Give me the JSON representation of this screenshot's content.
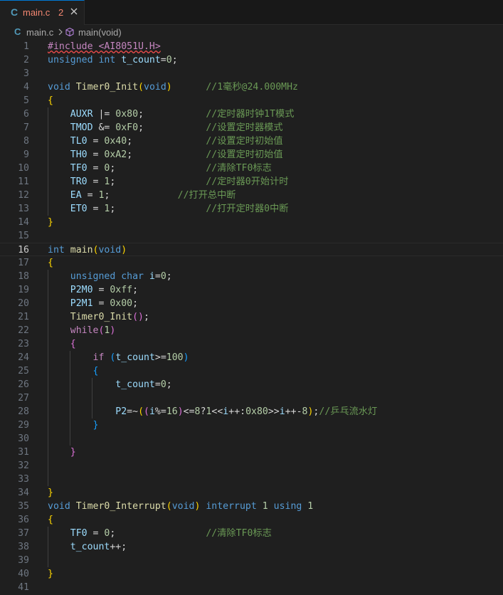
{
  "tab": {
    "language_icon": "C",
    "filename": "main.c",
    "problem_count": "2",
    "close_icon": "close-icon"
  },
  "breadcrumb": {
    "language_icon": "C",
    "file": "main.c",
    "symbol": "main(void)",
    "separator_icon": "chevron-right-icon",
    "symbol_icon": "cube-icon"
  },
  "editor": {
    "current_line": 16,
    "lines": [
      [
        {
          "t": "#include <AI8051U.H>",
          "c": "ctl err"
        }
      ],
      [
        {
          "t": "unsigned int ",
          "c": "kw"
        },
        {
          "t": "t_count",
          "c": "var"
        },
        {
          "t": "=",
          "c": "plain"
        },
        {
          "t": "0",
          "c": "num"
        },
        {
          "t": ";",
          "c": "plain"
        }
      ],
      [],
      [
        {
          "t": "void ",
          "c": "kw"
        },
        {
          "t": "Timer0_Init",
          "c": "fn"
        },
        {
          "t": "(",
          "c": "b1"
        },
        {
          "t": "void",
          "c": "kw"
        },
        {
          "t": ")",
          "c": "b1"
        },
        {
          "t": "      ",
          "c": "plain"
        },
        {
          "t": "//1毫秒@24.000MHz",
          "c": "cmt"
        }
      ],
      [
        {
          "t": "{",
          "c": "b1"
        }
      ],
      [
        {
          "t": "    ",
          "c": "plain"
        },
        {
          "t": "AUXR",
          "c": "var"
        },
        {
          "t": " |= ",
          "c": "plain"
        },
        {
          "t": "0x80",
          "c": "num"
        },
        {
          "t": ";           ",
          "c": "plain"
        },
        {
          "t": "//定时器时钟1T模式",
          "c": "cmt"
        }
      ],
      [
        {
          "t": "    ",
          "c": "plain"
        },
        {
          "t": "TMOD",
          "c": "var"
        },
        {
          "t": " &= ",
          "c": "plain"
        },
        {
          "t": "0xF0",
          "c": "num"
        },
        {
          "t": ";           ",
          "c": "plain"
        },
        {
          "t": "//设置定时器模式",
          "c": "cmt"
        }
      ],
      [
        {
          "t": "    ",
          "c": "plain"
        },
        {
          "t": "TL0",
          "c": "var"
        },
        {
          "t": " = ",
          "c": "plain"
        },
        {
          "t": "0x40",
          "c": "num"
        },
        {
          "t": ";             ",
          "c": "plain"
        },
        {
          "t": "//设置定时初始值",
          "c": "cmt"
        }
      ],
      [
        {
          "t": "    ",
          "c": "plain"
        },
        {
          "t": "TH0",
          "c": "var"
        },
        {
          "t": " = ",
          "c": "plain"
        },
        {
          "t": "0xA2",
          "c": "num"
        },
        {
          "t": ";             ",
          "c": "plain"
        },
        {
          "t": "//设置定时初始值",
          "c": "cmt"
        }
      ],
      [
        {
          "t": "    ",
          "c": "plain"
        },
        {
          "t": "TF0",
          "c": "var"
        },
        {
          "t": " = ",
          "c": "plain"
        },
        {
          "t": "0",
          "c": "num"
        },
        {
          "t": ";                ",
          "c": "plain"
        },
        {
          "t": "//清除TF0标志",
          "c": "cmt"
        }
      ],
      [
        {
          "t": "    ",
          "c": "plain"
        },
        {
          "t": "TR0",
          "c": "var"
        },
        {
          "t": " = ",
          "c": "plain"
        },
        {
          "t": "1",
          "c": "num"
        },
        {
          "t": ";                ",
          "c": "plain"
        },
        {
          "t": "//定时器0开始计时",
          "c": "cmt"
        }
      ],
      [
        {
          "t": "    ",
          "c": "plain"
        },
        {
          "t": "EA",
          "c": "var"
        },
        {
          "t": " = ",
          "c": "plain"
        },
        {
          "t": "1",
          "c": "num"
        },
        {
          "t": ";            ",
          "c": "plain"
        },
        {
          "t": "//打开总中断",
          "c": "cmt"
        }
      ],
      [
        {
          "t": "    ",
          "c": "plain"
        },
        {
          "t": "ET0",
          "c": "var"
        },
        {
          "t": " = ",
          "c": "plain"
        },
        {
          "t": "1",
          "c": "num"
        },
        {
          "t": ";                ",
          "c": "plain"
        },
        {
          "t": "//打开定时器0中断",
          "c": "cmt"
        }
      ],
      [
        {
          "t": "}",
          "c": "b1"
        }
      ],
      [],
      [
        {
          "t": "int ",
          "c": "kw"
        },
        {
          "t": "main",
          "c": "fn"
        },
        {
          "t": "(",
          "c": "b1"
        },
        {
          "t": "void",
          "c": "kw"
        },
        {
          "t": ")",
          "c": "b1"
        }
      ],
      [
        {
          "t": "{",
          "c": "b1"
        }
      ],
      [
        {
          "t": "    ",
          "c": "plain"
        },
        {
          "t": "unsigned char ",
          "c": "kw"
        },
        {
          "t": "i",
          "c": "var"
        },
        {
          "t": "=",
          "c": "plain"
        },
        {
          "t": "0",
          "c": "num"
        },
        {
          "t": ";",
          "c": "plain"
        }
      ],
      [
        {
          "t": "    ",
          "c": "plain"
        },
        {
          "t": "P2M0",
          "c": "var"
        },
        {
          "t": " = ",
          "c": "plain"
        },
        {
          "t": "0xff",
          "c": "num"
        },
        {
          "t": ";",
          "c": "plain"
        }
      ],
      [
        {
          "t": "    ",
          "c": "plain"
        },
        {
          "t": "P2M1",
          "c": "var"
        },
        {
          "t": " = ",
          "c": "plain"
        },
        {
          "t": "0x00",
          "c": "num"
        },
        {
          "t": ";",
          "c": "plain"
        }
      ],
      [
        {
          "t": "    ",
          "c": "plain"
        },
        {
          "t": "Timer0_Init",
          "c": "fn"
        },
        {
          "t": "()",
          "c": "b2"
        },
        {
          "t": ";",
          "c": "plain"
        }
      ],
      [
        {
          "t": "    ",
          "c": "plain"
        },
        {
          "t": "while",
          "c": "ctl"
        },
        {
          "t": "(",
          "c": "b2"
        },
        {
          "t": "1",
          "c": "num"
        },
        {
          "t": ")",
          "c": "b2"
        }
      ],
      [
        {
          "t": "    ",
          "c": "plain"
        },
        {
          "t": "{",
          "c": "b2"
        }
      ],
      [
        {
          "t": "        ",
          "c": "plain"
        },
        {
          "t": "if ",
          "c": "ctl"
        },
        {
          "t": "(",
          "c": "b3"
        },
        {
          "t": "t_count",
          "c": "var"
        },
        {
          "t": ">=",
          "c": "plain"
        },
        {
          "t": "100",
          "c": "num"
        },
        {
          "t": ")",
          "c": "b3"
        }
      ],
      [
        {
          "t": "        ",
          "c": "plain"
        },
        {
          "t": "{",
          "c": "b3"
        }
      ],
      [
        {
          "t": "            ",
          "c": "plain"
        },
        {
          "t": "t_count",
          "c": "var"
        },
        {
          "t": "=",
          "c": "plain"
        },
        {
          "t": "0",
          "c": "num"
        },
        {
          "t": ";",
          "c": "plain"
        }
      ],
      [],
      [
        {
          "t": "            ",
          "c": "plain"
        },
        {
          "t": "P2",
          "c": "var"
        },
        {
          "t": "=~",
          "c": "plain"
        },
        {
          "t": "(",
          "c": "b1"
        },
        {
          "t": "(",
          "c": "b2"
        },
        {
          "t": "i",
          "c": "var"
        },
        {
          "t": "%=",
          "c": "plain"
        },
        {
          "t": "16",
          "c": "num"
        },
        {
          "t": ")",
          "c": "b2"
        },
        {
          "t": "<=",
          "c": "plain"
        },
        {
          "t": "8",
          "c": "num"
        },
        {
          "t": "?",
          "c": "plain"
        },
        {
          "t": "1",
          "c": "num"
        },
        {
          "t": "<<",
          "c": "plain"
        },
        {
          "t": "i",
          "c": "var"
        },
        {
          "t": "++:",
          "c": "plain"
        },
        {
          "t": "0x80",
          "c": "num"
        },
        {
          "t": ">>",
          "c": "plain"
        },
        {
          "t": "i",
          "c": "var"
        },
        {
          "t": "++-",
          "c": "plain"
        },
        {
          "t": "8",
          "c": "num"
        },
        {
          "t": ")",
          "c": "b1"
        },
        {
          "t": ";",
          "c": "plain"
        },
        {
          "t": "//乒乓流水灯",
          "c": "cmt"
        }
      ],
      [
        {
          "t": "        ",
          "c": "plain"
        },
        {
          "t": "}",
          "c": "b3"
        }
      ],
      [],
      [
        {
          "t": "    ",
          "c": "plain"
        },
        {
          "t": "}",
          "c": "b2"
        }
      ],
      [],
      [],
      [
        {
          "t": "}",
          "c": "b1"
        }
      ],
      [
        {
          "t": "void ",
          "c": "kw"
        },
        {
          "t": "Timer0_Interrupt",
          "c": "fn"
        },
        {
          "t": "(",
          "c": "b1"
        },
        {
          "t": "void",
          "c": "kw"
        },
        {
          "t": ") ",
          "c": "b1"
        },
        {
          "t": "interrupt ",
          "c": "kw"
        },
        {
          "t": "1 ",
          "c": "num"
        },
        {
          "t": "using ",
          "c": "kw"
        },
        {
          "t": "1",
          "c": "num"
        }
      ],
      [
        {
          "t": "{",
          "c": "b1"
        }
      ],
      [
        {
          "t": "    ",
          "c": "plain"
        },
        {
          "t": "TF0",
          "c": "var"
        },
        {
          "t": " = ",
          "c": "plain"
        },
        {
          "t": "0",
          "c": "num"
        },
        {
          "t": ";                ",
          "c": "plain"
        },
        {
          "t": "//清除TF0标志",
          "c": "cmt"
        }
      ],
      [
        {
          "t": "    ",
          "c": "plain"
        },
        {
          "t": "t_count",
          "c": "var"
        },
        {
          "t": "++;",
          "c": "plain"
        }
      ],
      [],
      [
        {
          "t": "}",
          "c": "b1"
        }
      ],
      []
    ]
  }
}
